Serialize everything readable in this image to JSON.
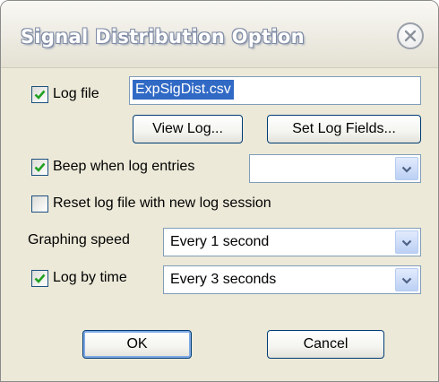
{
  "window": {
    "title": "Signal Distribution Option"
  },
  "log_file": {
    "label": "Log file",
    "checked": true,
    "value": "ExpSigDist.csv"
  },
  "buttons": {
    "view_log": "View Log...",
    "set_log_fields": "Set Log Fields...",
    "ok": "OK",
    "cancel": "Cancel"
  },
  "beep": {
    "label": "Beep when log entries",
    "checked": true,
    "value": ""
  },
  "reset_log": {
    "label": "Reset log file with new log session",
    "checked": false
  },
  "graphing_speed": {
    "label": "Graphing speed",
    "value": "Every 1 second"
  },
  "log_by_time": {
    "label": "Log by time",
    "checked": true,
    "value": "Every 3 seconds"
  },
  "icons": {
    "close": "close-icon",
    "check": "checkmark-icon",
    "dropdown": "chevron-down-icon"
  },
  "colors": {
    "dialog_bg": "#ece9d8",
    "selection": "#316ac5",
    "checkmark": "#21a121",
    "button_border": "#003c74"
  }
}
